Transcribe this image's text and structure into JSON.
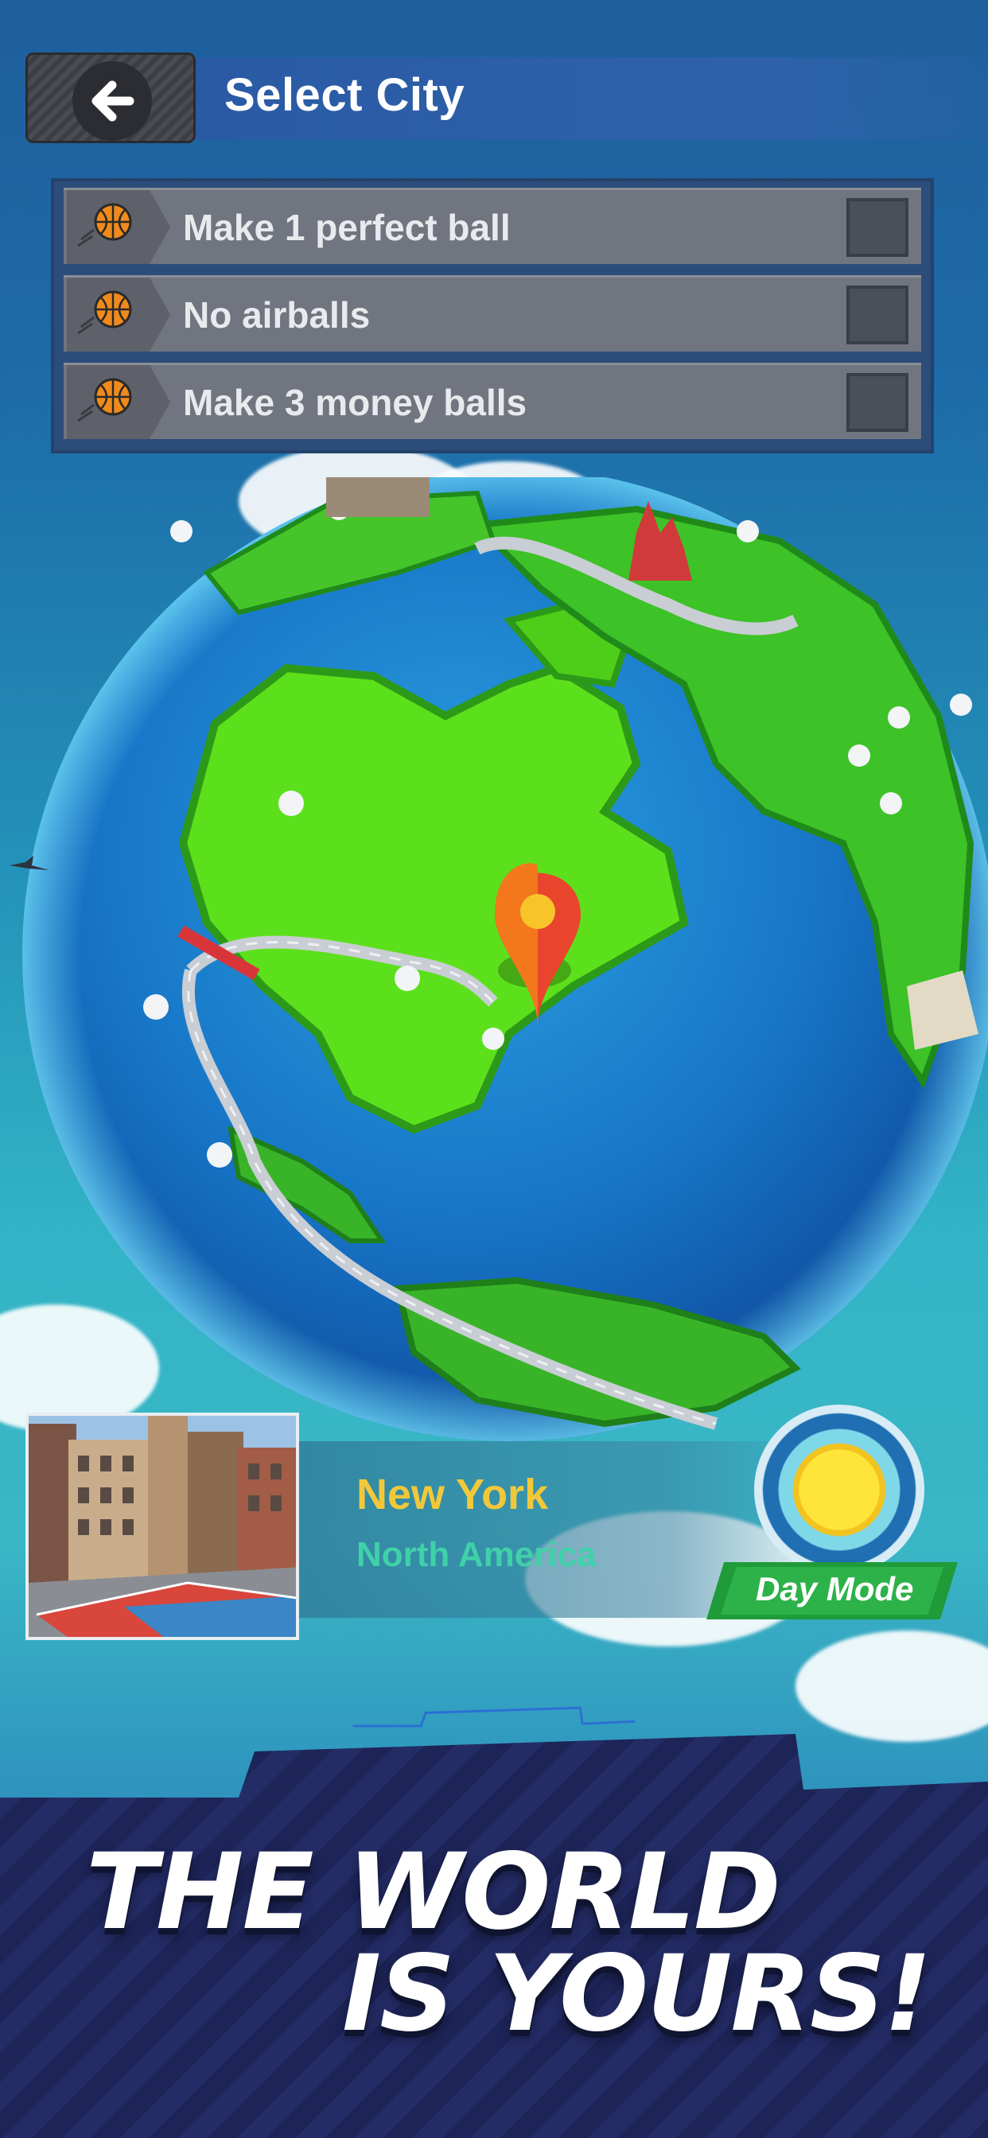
{
  "header": {
    "title": "Select City",
    "back_icon": "arrow-left-icon"
  },
  "goals": [
    {
      "label": "Make 1 perfect ball",
      "icon": "basketball-icon",
      "checked": false
    },
    {
      "label": "No airballs",
      "icon": "basketball-icon",
      "checked": false
    },
    {
      "label": "Make 3 money balls",
      "icon": "basketball-icon",
      "checked": false
    }
  ],
  "map": {
    "selected_marker_icon": "map-pin-icon",
    "pin_color": "#e8452c"
  },
  "city": {
    "name": "New York",
    "region": "North America",
    "name_color": "#f2c83a",
    "region_color": "#3fd1a8"
  },
  "mode": {
    "label": "Day Mode",
    "icon": "sun-icon"
  },
  "banner": {
    "line1": "THE WORLD",
    "line2": "IS YOURS!"
  }
}
